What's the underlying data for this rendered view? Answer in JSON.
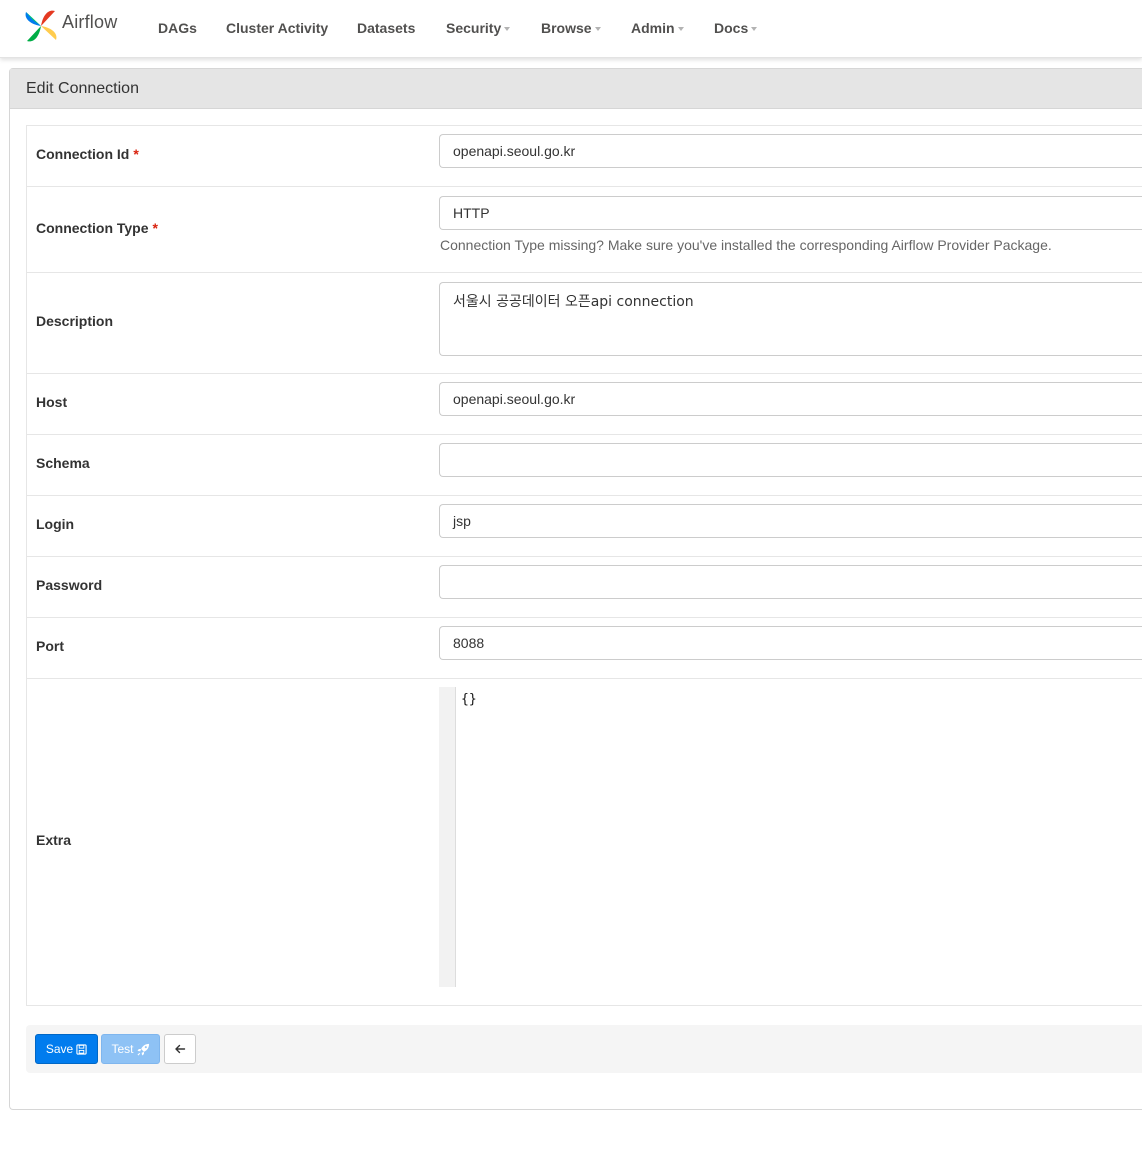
{
  "navbar": {
    "brand": "Airflow",
    "items": [
      {
        "label": "DAGs",
        "dropdown": false
      },
      {
        "label": "Cluster Activity",
        "dropdown": false
      },
      {
        "label": "Datasets",
        "dropdown": false
      },
      {
        "label": "Security",
        "dropdown": true
      },
      {
        "label": "Browse",
        "dropdown": true
      },
      {
        "label": "Admin",
        "dropdown": true
      },
      {
        "label": "Docs",
        "dropdown": true
      }
    ]
  },
  "panel": {
    "title": "Edit Connection"
  },
  "form": {
    "connection_id": {
      "label": "Connection Id",
      "required_mark": "*",
      "value": "openapi.seoul.go.kr"
    },
    "connection_type": {
      "label": "Connection Type",
      "required_mark": "*",
      "value": "HTTP",
      "help": "Connection Type missing? Make sure you've installed the corresponding Airflow Provider Package."
    },
    "description": {
      "label": "Description",
      "value": "서울시 공공데이터 오픈api connection"
    },
    "host": {
      "label": "Host",
      "value": "openapi.seoul.go.kr"
    },
    "schema": {
      "label": "Schema",
      "value": ""
    },
    "login": {
      "label": "Login",
      "value": "jsp"
    },
    "password": {
      "label": "Password",
      "value": ""
    },
    "port": {
      "label": "Port",
      "value": "8088"
    },
    "extra": {
      "label": "Extra",
      "value": "{}"
    }
  },
  "buttons": {
    "save": "Save",
    "save_icon": "floppy-disk-icon",
    "test": "Test",
    "test_icon": "rocket-icon",
    "back_icon": "arrow-left-icon"
  },
  "colors": {
    "primary": "#017cee",
    "primary_disabled": "#8ec2f5",
    "required": "#d9230f",
    "nav_text": "#51504f"
  }
}
